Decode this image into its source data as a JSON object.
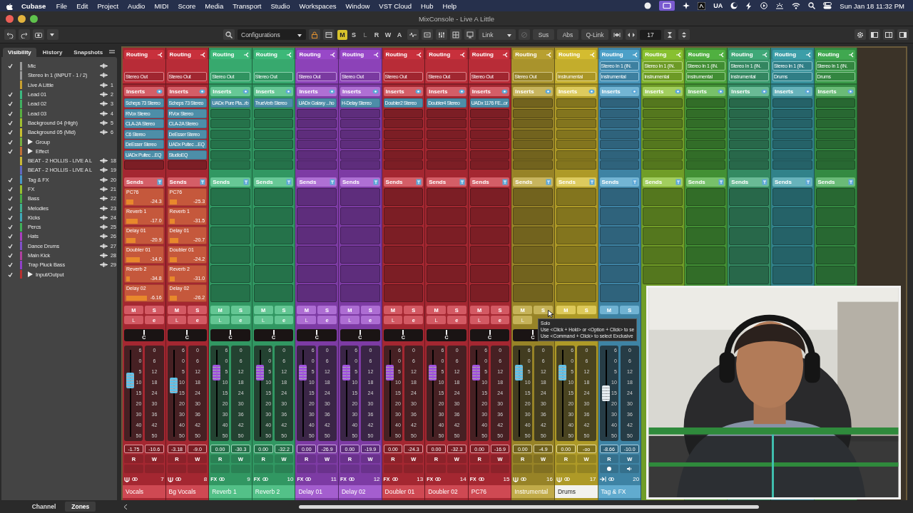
{
  "menu_bar": {
    "app": "Cubase",
    "items": [
      "File",
      "Edit",
      "Project",
      "Audio",
      "MIDI",
      "Score",
      "Media",
      "Transport",
      "Studio",
      "Workspaces",
      "Window",
      "VST Cloud",
      "Hub",
      "Help"
    ],
    "status_text": "UA",
    "clock": "Sun Jan 18  11:32 PM"
  },
  "window": {
    "title": "MixConsole - Live A Little"
  },
  "toolbar": {
    "configurations": "Configurations",
    "modes": [
      {
        "label": "M",
        "on": true,
        "disabled": false
      },
      {
        "label": "S",
        "on": false,
        "disabled": false
      },
      {
        "label": "L",
        "on": false,
        "disabled": true
      },
      {
        "label": "R",
        "on": false,
        "disabled": false
      },
      {
        "label": "W",
        "on": false,
        "disabled": false
      },
      {
        "label": "A",
        "on": false,
        "disabled": false
      }
    ],
    "link": "Link",
    "sus": "Sus",
    "abs": "Abs",
    "qlink": "Q-Link",
    "count": "17"
  },
  "visibility_panel": {
    "tabs": [
      {
        "label": "Visibility",
        "selected": true
      },
      {
        "label": "History",
        "selected": false
      },
      {
        "label": "Snapshots",
        "selected": false
      }
    ],
    "items": [
      {
        "kind": "track",
        "name": "Mic",
        "checked": true,
        "color": "#9a9a9a"
      },
      {
        "kind": "track",
        "name": "Stereo In 1 (INPUT - 1 / 2)",
        "checked": false,
        "color": "#9a9a9a"
      },
      {
        "kind": "track",
        "name": "Live A Little",
        "checked": false,
        "color": "#c8a030",
        "number": "1"
      },
      {
        "kind": "track",
        "name": "Lead 01",
        "checked": true,
        "color": "#3cb880",
        "number": "2"
      },
      {
        "kind": "track",
        "name": "Lead 02",
        "checked": true,
        "color": "#40b060",
        "number": "3"
      },
      {
        "kind": "track",
        "name": "Lead 03",
        "checked": true,
        "color": "#58b040",
        "number": "4"
      },
      {
        "kind": "track",
        "name": "Background 04 (High)",
        "checked": true,
        "color": "#a0c030",
        "number": "5"
      },
      {
        "kind": "track",
        "name": "Background 05 (Mid)",
        "checked": true,
        "color": "#c8c030",
        "number": "6"
      },
      {
        "kind": "folder",
        "name": "Group",
        "checked": true,
        "color": "#78b040",
        "expanded": false
      },
      {
        "kind": "folder",
        "name": "Effect",
        "checked": true,
        "color": "#c07038",
        "expanded": false
      },
      {
        "kind": "track",
        "name": "BEAT - 2 HOLLIS - LIVE A L",
        "checked": false,
        "color": "#c8b838",
        "number": "18"
      },
      {
        "kind": "track",
        "name": "BEAT - 2 HOLLIS - LIVE A L",
        "checked": false,
        "color": "#6068c0",
        "number": "19"
      },
      {
        "kind": "track",
        "name": "Tag & FX",
        "checked": true,
        "color": "#4898c8",
        "number": "20"
      },
      {
        "kind": "track",
        "name": "FX",
        "checked": true,
        "color": "#98c030",
        "number": "21"
      },
      {
        "kind": "track",
        "name": "Bass",
        "checked": true,
        "color": "#48a848",
        "number": "22"
      },
      {
        "kind": "track",
        "name": "Melodies",
        "checked": true,
        "color": "#40b090",
        "number": "23"
      },
      {
        "kind": "track",
        "name": "Kicks",
        "checked": true,
        "color": "#40a8b8",
        "number": "24"
      },
      {
        "kind": "track",
        "name": "Percs",
        "checked": true,
        "color": "#40b058",
        "number": "25"
      },
      {
        "kind": "track",
        "name": "Hats",
        "checked": true,
        "color": "#a840c0",
        "number": "26"
      },
      {
        "kind": "track",
        "name": "Dance Drums",
        "checked": true,
        "color": "#8050c8",
        "number": "27"
      },
      {
        "kind": "track",
        "name": "Main Kick",
        "checked": true,
        "color": "#b040a0",
        "number": "28"
      },
      {
        "kind": "track",
        "name": "Trap Pluck Bass",
        "checked": true,
        "color": "#9040c8",
        "number": "29"
      },
      {
        "kind": "folder",
        "name": "Input/Output",
        "checked": true,
        "color": "#b83030",
        "expanded": false
      }
    ]
  },
  "channels": [
    {
      "name": "Vocals",
      "number": "7",
      "color": "#c8303c",
      "selected": false,
      "kind": "audio",
      "routing": "Routing",
      "output": "Stereo Out",
      "inserts_label": "Inserts",
      "inserts": [
        "Scheps 73 Stereo",
        "RVox Stereo",
        "CLA-2A Stereo",
        "C6 Stereo",
        "DeEsser Stereo",
        "UADx Pultec ...EQ"
      ],
      "sends_label": "Sends",
      "sends": [
        {
          "name": "PC76",
          "level": 0.2,
          "value": "-24.3"
        },
        {
          "name": "Reverb 1",
          "level": 0.32,
          "value": "-17.0"
        },
        {
          "name": "Delay 01",
          "level": 0.26,
          "value": "-20.9"
        },
        {
          "name": "Doubler 01",
          "level": 0.38,
          "value": "-14.0"
        },
        {
          "name": "Reverb 2",
          "level": 0.1,
          "value": "-34.8"
        },
        {
          "name": "Delay 02",
          "level": 0.58,
          "value": "-6.16"
        }
      ],
      "strip": {
        "mute": "M",
        "solo": "S",
        "listen": "L",
        "edit": "e",
        "pan": "C",
        "level": 0.66,
        "fader_scale": [
          "6",
          "0",
          "5",
          "10",
          "15",
          "20",
          "30",
          "40",
          "50"
        ],
        "meter_scale": [
          "0",
          "6",
          "12",
          "18",
          "24",
          "30",
          "36",
          "42",
          "50"
        ],
        "volume": "-1.75",
        "peak": "-10.6",
        "read": "R",
        "write": "W"
      }
    },
    {
      "name": "Bg Vocals",
      "number": "8",
      "color": "#c8303c",
      "selected": false,
      "kind": "audio",
      "routing": "Routing",
      "output": "Stereo Out",
      "inserts_label": "Inserts",
      "inserts": [
        "Scheps 73 Stereo",
        "RVox Stereo",
        "CLA-2A Stereo",
        "DeEsser Stereo",
        "UADx Pultec ...EQ",
        "StudioEQ"
      ],
      "sends_label": "Sends",
      "sends": [
        {
          "name": "PC76",
          "level": 0.2,
          "value": "-25.3"
        },
        {
          "name": "Reverb 1",
          "level": 0.15,
          "value": "-31.5"
        },
        {
          "name": "Delay 01",
          "level": 0.26,
          "value": "-20.7"
        },
        {
          "name": "Doubler 01",
          "level": 0.2,
          "value": "-24.2"
        },
        {
          "name": "Reverb 2",
          "level": 0.14,
          "value": "-31.0"
        },
        {
          "name": "Delay 02",
          "level": 0.2,
          "value": "-26.2"
        }
      ],
      "strip": {
        "mute": "M",
        "solo": "S",
        "listen": "L",
        "edit": "e",
        "pan": "C",
        "level": 0.6,
        "fader_scale": [
          "6",
          "0",
          "5",
          "10",
          "15",
          "20",
          "30",
          "40",
          "50"
        ],
        "meter_scale": [
          "0",
          "6",
          "12",
          "18",
          "24",
          "30",
          "36",
          "42",
          "50"
        ],
        "volume": "-3.18",
        "peak": "-9.0",
        "read": "R",
        "write": "W"
      }
    },
    {
      "name": "Reverb 1",
      "number": "9",
      "color": "#3cb878",
      "selected": false,
      "kind": "fx",
      "badge": "FX",
      "routing": "Routing",
      "output": "Stereo Out",
      "inserts_label": "Inserts",
      "inserts": [
        "UADx Pure Pla...rb"
      ],
      "sends_label": "Sends",
      "strip": {
        "mute": "M",
        "solo": "S",
        "listen": "L",
        "edit": "e",
        "pan": "C",
        "level": 0.76,
        "fader_scale": [
          "6",
          "0",
          "5",
          "10",
          "15",
          "20",
          "30",
          "40",
          "50"
        ],
        "meter_scale": [
          "0",
          "6",
          "12",
          "18",
          "24",
          "30",
          "36",
          "42",
          "50"
        ],
        "volume": "0.00",
        "peak": "-30.3",
        "read": "R",
        "write": "W"
      }
    },
    {
      "name": "Reverb 2",
      "number": "10",
      "color": "#3cb878",
      "selected": false,
      "kind": "fx",
      "badge": "FX",
      "routing": "Routing",
      "output": "Stereo Out",
      "inserts_label": "Inserts",
      "inserts": [
        "TrueVerb Stereo"
      ],
      "sends_label": "Sends",
      "strip": {
        "mute": "M",
        "solo": "S",
        "listen": "L",
        "edit": "e",
        "pan": "C",
        "level": 0.76,
        "fader_scale": [
          "6",
          "0",
          "5",
          "10",
          "15",
          "20",
          "30",
          "40",
          "50"
        ],
        "meter_scale": [
          "0",
          "6",
          "12",
          "18",
          "24",
          "30",
          "36",
          "42",
          "50"
        ],
        "volume": "0.00",
        "peak": "-32.2",
        "read": "R",
        "write": "W"
      }
    },
    {
      "name": "Delay 01",
      "number": "11",
      "color": "#9848c8",
      "selected": false,
      "kind": "fx",
      "badge": "FX",
      "routing": "Routing",
      "output": "Stereo Out",
      "inserts_label": "Inserts",
      "inserts": [
        "UADx Galaxy ...ho"
      ],
      "sends_label": "Sends",
      "strip": {
        "mute": "M",
        "solo": "S",
        "listen": "L",
        "edit": "e",
        "pan": "C",
        "level": 0.76,
        "fader_scale": [
          "6",
          "0",
          "5",
          "10",
          "15",
          "20",
          "30",
          "40",
          "50"
        ],
        "meter_scale": [
          "0",
          "6",
          "12",
          "18",
          "24",
          "30",
          "36",
          "42",
          "50"
        ],
        "volume": "0.00",
        "peak": "-26.9",
        "read": "R",
        "write": "W"
      }
    },
    {
      "name": "Delay 02",
      "number": "12",
      "color": "#9848c8",
      "selected": false,
      "kind": "fx",
      "badge": "FX",
      "routing": "Routing",
      "output": "Stereo Out",
      "inserts_label": "Inserts",
      "inserts": [
        "H-Delay Stereo"
      ],
      "sends_label": "Sends",
      "strip": {
        "mute": "M",
        "solo": "S",
        "listen": "L",
        "edit": "e",
        "pan": "C",
        "level": 0.76,
        "fader_scale": [
          "6",
          "0",
          "5",
          "10",
          "15",
          "20",
          "30",
          "40",
          "50"
        ],
        "meter_scale": [
          "0",
          "6",
          "12",
          "18",
          "24",
          "30",
          "36",
          "42",
          "50"
        ],
        "volume": "0.00",
        "peak": "-19.9",
        "read": "R",
        "write": "W"
      }
    },
    {
      "name": "Doubler 01",
      "number": "13",
      "color": "#c8303c",
      "selected": false,
      "kind": "fx",
      "badge": "FX",
      "routing": "Routing",
      "output": "Stereo Out",
      "inserts_label": "Inserts",
      "inserts": [
        "Doubler2 Stereo"
      ],
      "sends_label": "Sends",
      "strip": {
        "mute": "M",
        "solo": "S",
        "listen": "L",
        "edit": "e",
        "pan": "C",
        "level": 0.76,
        "fader_scale": [
          "6",
          "0",
          "5",
          "10",
          "15",
          "20",
          "30",
          "40",
          "50"
        ],
        "meter_scale": [
          "0",
          "6",
          "12",
          "18",
          "24",
          "30",
          "36",
          "42",
          "50"
        ],
        "volume": "0.00",
        "peak": "-24.3",
        "read": "R",
        "write": "W"
      }
    },
    {
      "name": "Doubler 02",
      "number": "14",
      "color": "#c8303c",
      "selected": false,
      "kind": "fx",
      "badge": "FX",
      "routing": "Routing",
      "output": "Stereo Out",
      "inserts_label": "Inserts",
      "inserts": [
        "Doubler4 Stereo"
      ],
      "sends_label": "Sends",
      "strip": {
        "mute": "M",
        "solo": "S",
        "listen": "L",
        "edit": "e",
        "pan": "C",
        "level": 0.76,
        "fader_scale": [
          "6",
          "0",
          "5",
          "10",
          "15",
          "20",
          "30",
          "40",
          "50"
        ],
        "meter_scale": [
          "0",
          "6",
          "12",
          "18",
          "24",
          "30",
          "36",
          "42",
          "50"
        ],
        "volume": "0.00",
        "peak": "-32.3",
        "read": "R",
        "write": "W"
      }
    },
    {
      "name": "PC76",
      "number": "15",
      "color": "#c8303c",
      "selected": false,
      "kind": "fx",
      "badge": "FX",
      "routing": "Routing",
      "output": "Stereo Out",
      "inserts_label": "Inserts",
      "inserts": [
        "UADx 1176 FE...or"
      ],
      "sends_label": "Sends",
      "strip": {
        "mute": "M",
        "solo": "S",
        "listen": "L",
        "edit": "e",
        "pan": "C",
        "level": 0.76,
        "fader_scale": [
          "6",
          "0",
          "5",
          "10",
          "15",
          "20",
          "30",
          "40",
          "50"
        ],
        "meter_scale": [
          "0",
          "6",
          "12",
          "18",
          "24",
          "30",
          "36",
          "42",
          "50"
        ],
        "volume": "0.00",
        "peak": "-16.9",
        "read": "R",
        "write": "W"
      }
    },
    {
      "name": "Instrumental",
      "number": "16",
      "color": "#b8a030",
      "selected": false,
      "kind": "audio",
      "routing": "Routing",
      "output": "Stereo Out",
      "inserts_label": "Inserts",
      "sends_label": "Sends",
      "strip": {
        "mute": "M",
        "solo": "S",
        "listen": "L",
        "pan": "C",
        "level": 0.76,
        "fader_scale": [
          "6",
          "0",
          "5",
          "10",
          "15",
          "20",
          "30",
          "40",
          "50"
        ],
        "meter_scale": [
          "0",
          "6",
          "12",
          "18",
          "24",
          "30",
          "36",
          "42",
          "50"
        ],
        "volume": "0.00",
        "peak": "-4.9",
        "read": "R",
        "write": "W"
      }
    },
    {
      "name": "Drums",
      "number": "17",
      "color": "#d4bc30",
      "selected": true,
      "kind": "audio",
      "routing": "Routing",
      "output": "Instrumental",
      "inserts_label": "Inserts",
      "sends_label": "Sends",
      "strip": {
        "mute": "M",
        "solo": "S",
        "level": 0.76,
        "fader_scale": [
          "6",
          "0",
          "5",
          "10",
          "15",
          "20",
          "30",
          "40",
          "50"
        ],
        "meter_scale": [
          "0",
          "6",
          "12",
          "18",
          "24",
          "30",
          "36",
          "42",
          "50"
        ],
        "volume": "0.00",
        "peak": "-oo",
        "read": "R",
        "write": "W"
      }
    },
    {
      "name": "Tag & FX",
      "number": "20",
      "color": "#4ca0c8",
      "selected": false,
      "kind": "input",
      "routing": "Routing",
      "input": "Stereo In 1 (IN.",
      "output": "Instrumental",
      "inserts_label": "Inserts",
      "sends_label": "Sends",
      "strip": {
        "mute": "M",
        "solo": "S",
        "level": 0.5,
        "fader_scale": [
          "6",
          "0",
          "5",
          "10",
          "15",
          "20",
          "30",
          "40",
          "50"
        ],
        "meter_scale": [
          "0",
          "6",
          "12",
          "18",
          "24",
          "30",
          "36",
          "42",
          "50"
        ],
        "volume": "-8.66",
        "peak": "-10.0",
        "read": "R",
        "write": "W"
      }
    },
    {
      "color": "#88c030",
      "routing": "Routing",
      "input": "Stereo In 1 (IN.",
      "output": "Instrumental",
      "inserts_label": "Inserts",
      "sends_label": "Sends"
    },
    {
      "color": "#50b040",
      "routing": "Routing",
      "input": "Stereo In 1 (IN.",
      "output": "Instrumental",
      "inserts_label": "Inserts",
      "sends_label": "Sends"
    },
    {
      "color": "#40a878",
      "routing": "Routing",
      "input": "Stereo In 1 (IN.",
      "output": "Instrumental",
      "inserts_label": "Inserts",
      "sends_label": "Sends"
    },
    {
      "color": "#3c9ea8",
      "routing": "Routing",
      "input": "Stereo In 1 (IN.",
      "output": "Drums",
      "inserts_label": "Inserts",
      "sends_label": "Sends"
    },
    {
      "color": "#40a850",
      "routing": "Routing",
      "input": "Stereo In 1 (IN.",
      "output": "Drums",
      "inserts_label": "Inserts",
      "sends_label": "Sends"
    }
  ],
  "tooltip": {
    "title": "Solo",
    "lines": [
      "Use <Click + Hold> or <Option + Click> to se",
      "Use <Command + Click> to select Exclusive"
    ]
  },
  "bottom_tabs": [
    {
      "label": "Channel",
      "selected": false
    },
    {
      "label": "Zones",
      "selected": true
    }
  ]
}
